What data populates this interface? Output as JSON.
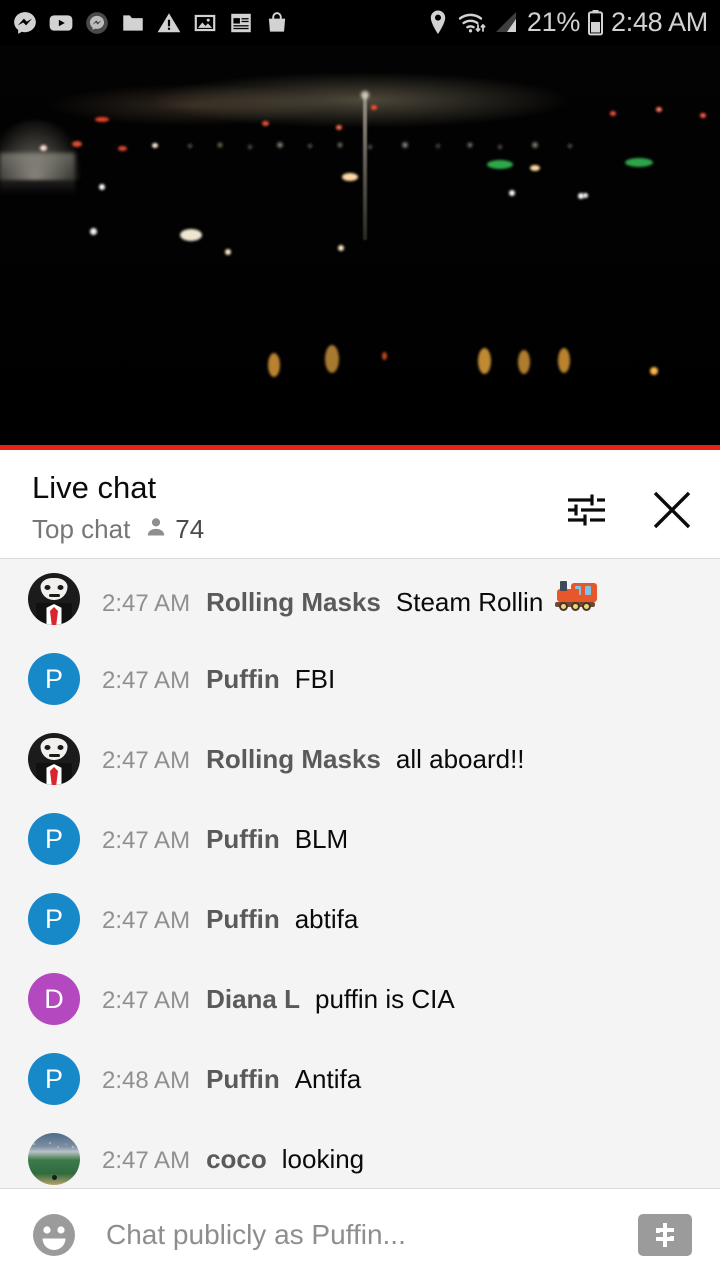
{
  "status_bar": {
    "time": "2:48 AM",
    "battery_percent": "21%",
    "notification_icons": [
      "messenger-icon",
      "youtube-icon",
      "messenger-secondary-icon",
      "folder-icon",
      "warning-icon",
      "photos-icon",
      "news-icon",
      "shopping-bag-icon"
    ],
    "system_icons": [
      "location-icon",
      "wifi-icon",
      "cellular-signal-icon",
      "battery-icon"
    ]
  },
  "video": {
    "description": "night-cityscape-live-stream",
    "progress_color": "#e62117"
  },
  "chat_header": {
    "title": "Live chat",
    "mode": "Top chat",
    "viewer_count": "74",
    "viewer_icon": "person-icon",
    "settings_icon": "tune-sliders-icon",
    "close_icon": "close-x-icon"
  },
  "messages": [
    {
      "time": "2:47 AM",
      "author": "Rolling Masks",
      "text": "Steam Rollin",
      "emoji": "locomotive",
      "avatar_type": "anon-mask",
      "avatar_initial": "",
      "avatar_color": "#1c1b1b"
    },
    {
      "time": "2:47 AM",
      "author": "Puffin",
      "text": "FBI",
      "emoji": "",
      "avatar_type": "initial",
      "avatar_initial": "P",
      "avatar_color": "#1789c8"
    },
    {
      "time": "2:47 AM",
      "author": "Rolling Masks",
      "text": "all aboard!!",
      "emoji": "",
      "avatar_type": "anon-mask",
      "avatar_initial": "",
      "avatar_color": "#1c1b1b"
    },
    {
      "time": "2:47 AM",
      "author": "Puffin",
      "text": "BLM",
      "emoji": "",
      "avatar_type": "initial",
      "avatar_initial": "P",
      "avatar_color": "#1789c8"
    },
    {
      "time": "2:47 AM",
      "author": "Puffin",
      "text": "abtifa",
      "emoji": "",
      "avatar_type": "initial",
      "avatar_initial": "P",
      "avatar_color": "#1789c8"
    },
    {
      "time": "2:47 AM",
      "author": "Diana L",
      "text": "puffin is CIA",
      "emoji": "",
      "avatar_type": "initial",
      "avatar_initial": "D",
      "avatar_color": "#b348bf"
    },
    {
      "time": "2:48 AM",
      "author": "Puffin",
      "text": "Antifa",
      "emoji": "",
      "avatar_type": "initial",
      "avatar_initial": "P",
      "avatar_color": "#1789c8"
    },
    {
      "time": "2:47 AM",
      "author": "coco",
      "text": "looking",
      "emoji": "",
      "avatar_type": "photo",
      "avatar_initial": "",
      "avatar_color": "#3e7a4a"
    }
  ],
  "input_bar": {
    "emoji_icon": "smiley-face-icon",
    "placeholder": "Chat publicly as Puffin...",
    "value": "",
    "superchat_icon": "dollar-sign-icon"
  }
}
